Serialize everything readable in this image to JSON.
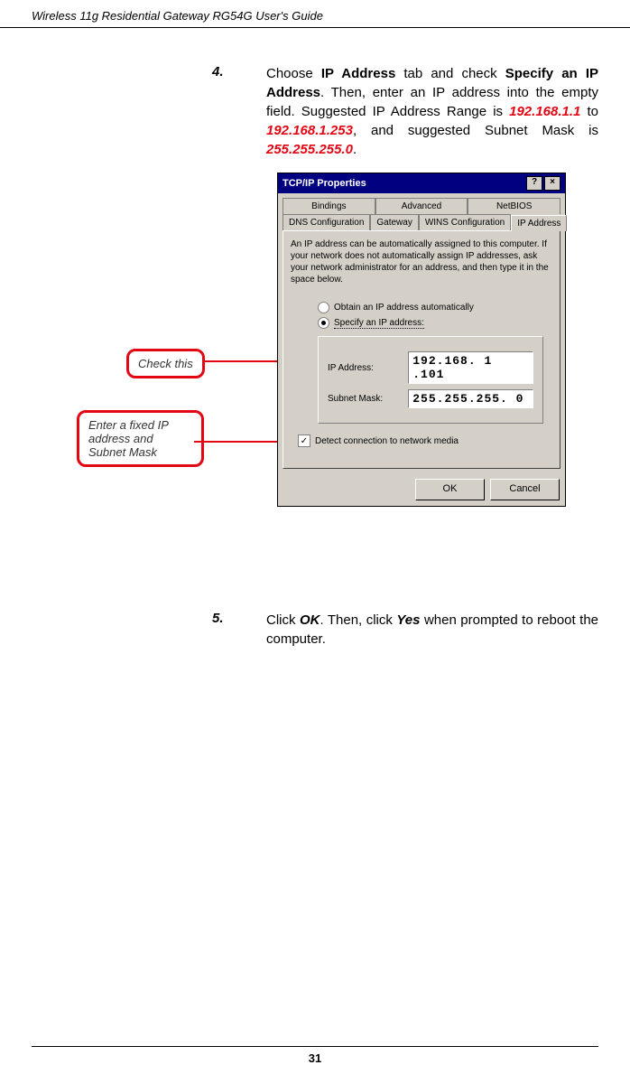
{
  "header": {
    "title": "Wireless 11g Residential Gateway RG54G User's Guide"
  },
  "step4": {
    "num": "4.",
    "textPrefix": "Choose ",
    "boldA": "IP Address",
    "mid1": " tab and check ",
    "boldB": "Specify an IP Address",
    "mid2": ".  Then, enter an IP address into the empty field.  Suggested IP Address Range is ",
    "ip1": "192.168.1.1",
    "mid3": " to ",
    "ip2": "192.168.1.253",
    "mid4": ", and suggested Subnet Mask is ",
    "mask": "255.255.255.0",
    "end": "."
  },
  "callouts": {
    "check": "Check this",
    "enter": "Enter a fixed IP address and Subnet Mask"
  },
  "dialog": {
    "title": "TCP/IP Properties",
    "tabs_row1": {
      "a": "Bindings",
      "b": "Advanced",
      "c": "NetBIOS"
    },
    "tabs_row2": {
      "a": "DNS Configuration",
      "b": "Gateway",
      "c": "WINS Configuration",
      "d": "IP Address"
    },
    "info": "An IP address can be automatically assigned to this computer. If your network does not automatically assign IP addresses, ask your network administrator for an address, and then type it in the space below.",
    "radio_obtain": "Obtain an IP address automatically",
    "radio_specify": "Specify an IP address:",
    "label_ip": "IP Address:",
    "value_ip": "192.168. 1 .101",
    "label_mask": "Subnet Mask:",
    "value_mask": "255.255.255. 0",
    "detect": "Detect connection to network media",
    "ok": "OK",
    "cancel": "Cancel"
  },
  "step5": {
    "num": "5.",
    "textPrefix": "Click ",
    "ok": "OK",
    "mid": ".  Then, click ",
    "yes": "Yes",
    "end": " when prompted to reboot the computer."
  },
  "pagenum": "31"
}
